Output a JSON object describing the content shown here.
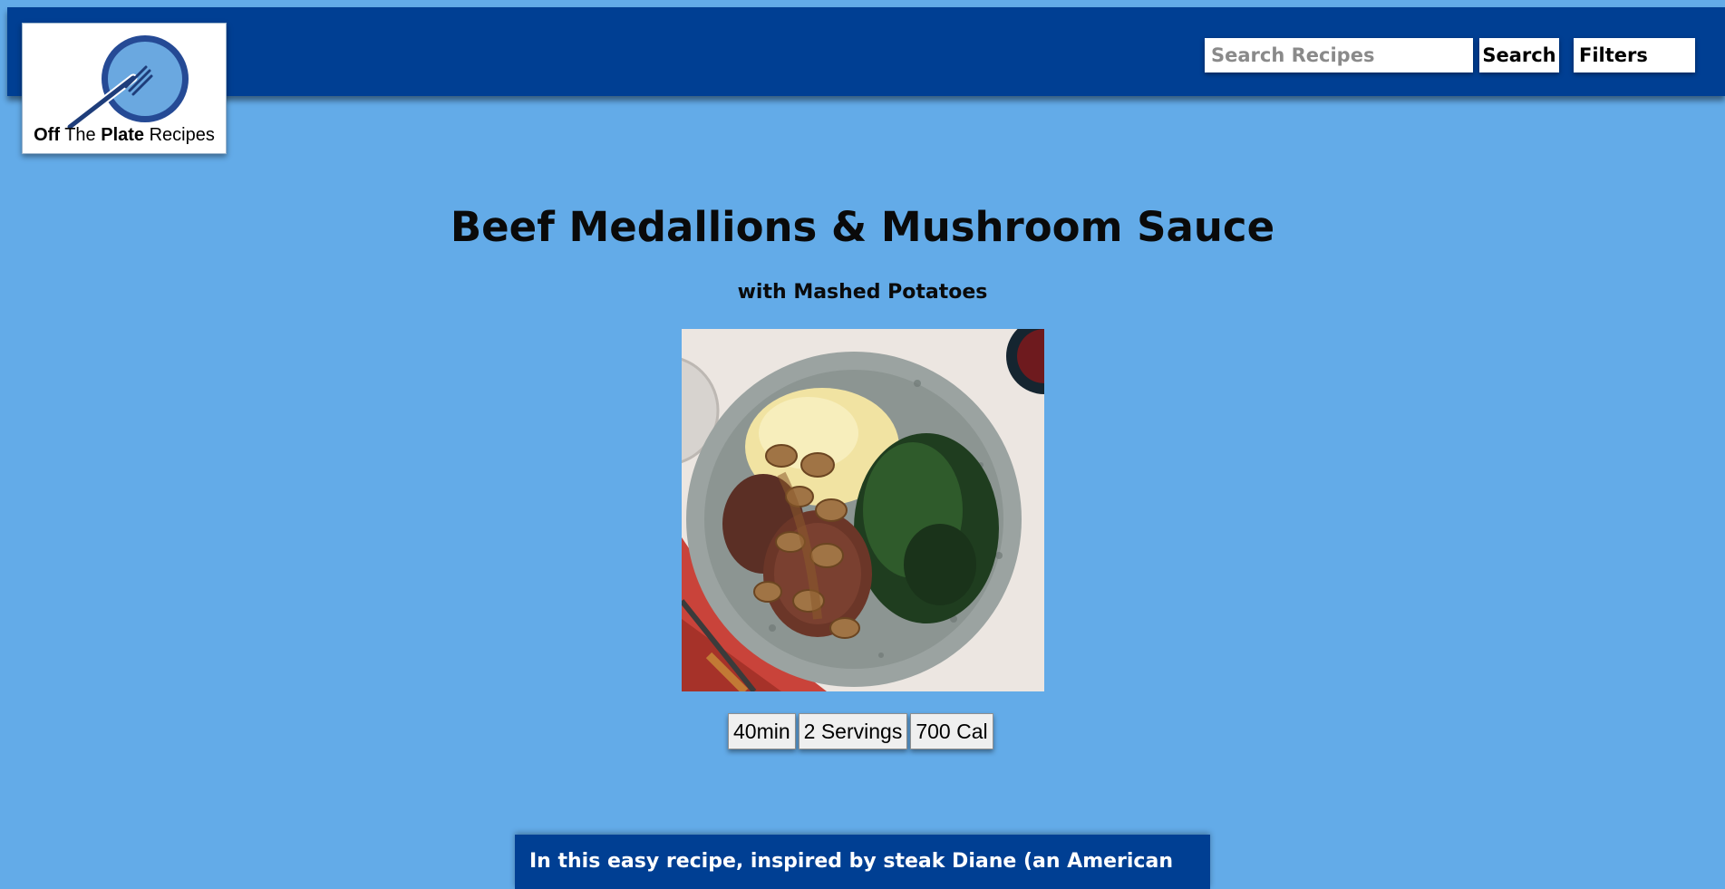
{
  "site": {
    "logo_word_1": "Off",
    "logo_word_2": "The",
    "logo_word_3": "Plate",
    "logo_word_4": "Recipes",
    "logo_icon": "plate-fork-icon"
  },
  "header": {
    "search_placeholder": "Search Recipes",
    "search_value": "",
    "search_button": "Search",
    "filters_button": "Filters"
  },
  "recipe": {
    "title": "Beef Medallions & Mushroom Sauce",
    "subtitle": "with Mashed Potatoes",
    "image_alt": "Beef medallions with mushroom sauce, mashed potatoes and kale on a plate",
    "stats": {
      "time": "40min",
      "servings": "2 Servings",
      "calories": "700 Cal"
    },
    "description": "In this easy recipe, inspired by steak Diane (an American"
  },
  "colors": {
    "page_background": "#63abe8",
    "header_background": "#003f93",
    "description_background": "#003f93"
  }
}
